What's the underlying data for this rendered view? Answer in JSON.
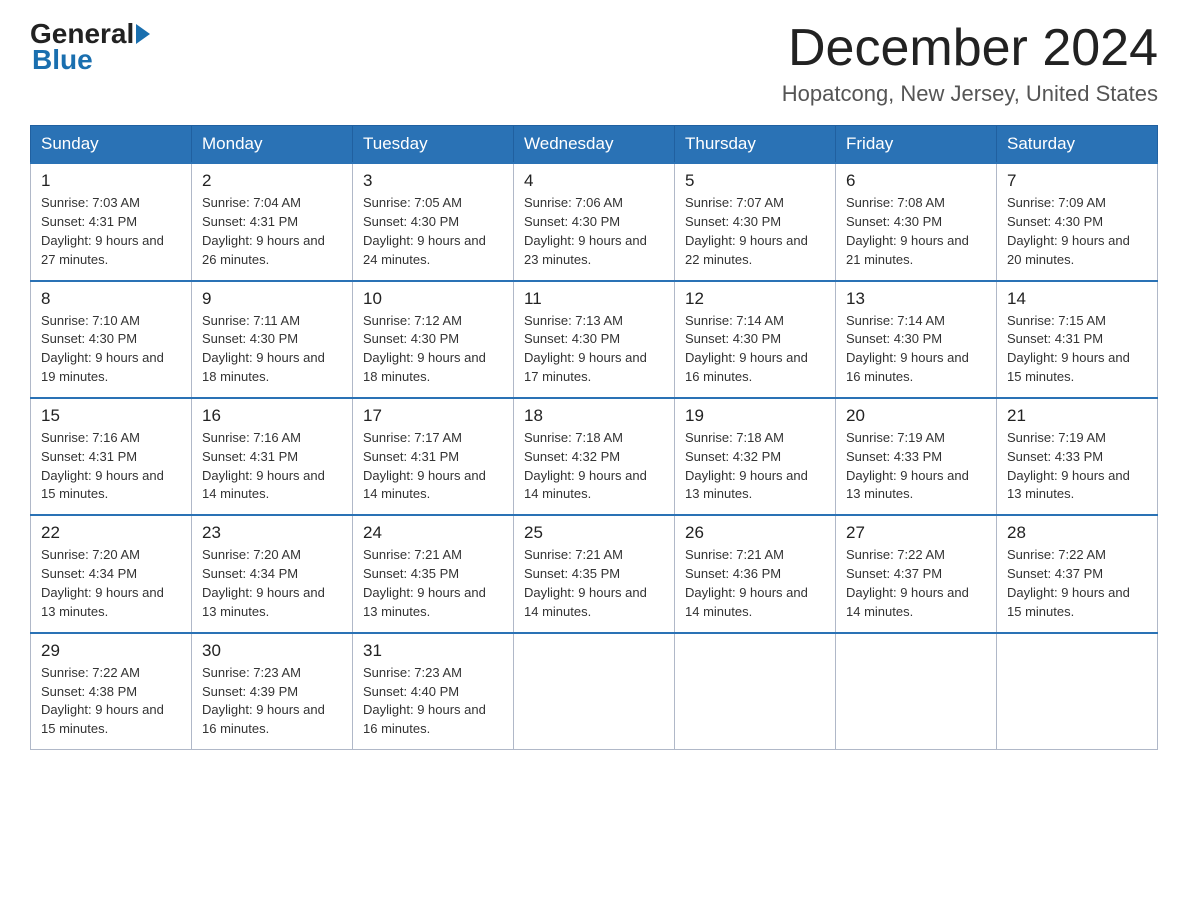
{
  "logo": {
    "general": "General",
    "blue": "Blue"
  },
  "header": {
    "month": "December 2024",
    "location": "Hopatcong, New Jersey, United States"
  },
  "weekdays": [
    "Sunday",
    "Monday",
    "Tuesday",
    "Wednesday",
    "Thursday",
    "Friday",
    "Saturday"
  ],
  "weeks": [
    [
      {
        "day": "1",
        "sunrise": "7:03 AM",
        "sunset": "4:31 PM",
        "daylight": "9 hours and 27 minutes."
      },
      {
        "day": "2",
        "sunrise": "7:04 AM",
        "sunset": "4:31 PM",
        "daylight": "9 hours and 26 minutes."
      },
      {
        "day": "3",
        "sunrise": "7:05 AM",
        "sunset": "4:30 PM",
        "daylight": "9 hours and 24 minutes."
      },
      {
        "day": "4",
        "sunrise": "7:06 AM",
        "sunset": "4:30 PM",
        "daylight": "9 hours and 23 minutes."
      },
      {
        "day": "5",
        "sunrise": "7:07 AM",
        "sunset": "4:30 PM",
        "daylight": "9 hours and 22 minutes."
      },
      {
        "day": "6",
        "sunrise": "7:08 AM",
        "sunset": "4:30 PM",
        "daylight": "9 hours and 21 minutes."
      },
      {
        "day": "7",
        "sunrise": "7:09 AM",
        "sunset": "4:30 PM",
        "daylight": "9 hours and 20 minutes."
      }
    ],
    [
      {
        "day": "8",
        "sunrise": "7:10 AM",
        "sunset": "4:30 PM",
        "daylight": "9 hours and 19 minutes."
      },
      {
        "day": "9",
        "sunrise": "7:11 AM",
        "sunset": "4:30 PM",
        "daylight": "9 hours and 18 minutes."
      },
      {
        "day": "10",
        "sunrise": "7:12 AM",
        "sunset": "4:30 PM",
        "daylight": "9 hours and 18 minutes."
      },
      {
        "day": "11",
        "sunrise": "7:13 AM",
        "sunset": "4:30 PM",
        "daylight": "9 hours and 17 minutes."
      },
      {
        "day": "12",
        "sunrise": "7:14 AM",
        "sunset": "4:30 PM",
        "daylight": "9 hours and 16 minutes."
      },
      {
        "day": "13",
        "sunrise": "7:14 AM",
        "sunset": "4:30 PM",
        "daylight": "9 hours and 16 minutes."
      },
      {
        "day": "14",
        "sunrise": "7:15 AM",
        "sunset": "4:31 PM",
        "daylight": "9 hours and 15 minutes."
      }
    ],
    [
      {
        "day": "15",
        "sunrise": "7:16 AM",
        "sunset": "4:31 PM",
        "daylight": "9 hours and 15 minutes."
      },
      {
        "day": "16",
        "sunrise": "7:16 AM",
        "sunset": "4:31 PM",
        "daylight": "9 hours and 14 minutes."
      },
      {
        "day": "17",
        "sunrise": "7:17 AM",
        "sunset": "4:31 PM",
        "daylight": "9 hours and 14 minutes."
      },
      {
        "day": "18",
        "sunrise": "7:18 AM",
        "sunset": "4:32 PM",
        "daylight": "9 hours and 14 minutes."
      },
      {
        "day": "19",
        "sunrise": "7:18 AM",
        "sunset": "4:32 PM",
        "daylight": "9 hours and 13 minutes."
      },
      {
        "day": "20",
        "sunrise": "7:19 AM",
        "sunset": "4:33 PM",
        "daylight": "9 hours and 13 minutes."
      },
      {
        "day": "21",
        "sunrise": "7:19 AM",
        "sunset": "4:33 PM",
        "daylight": "9 hours and 13 minutes."
      }
    ],
    [
      {
        "day": "22",
        "sunrise": "7:20 AM",
        "sunset": "4:34 PM",
        "daylight": "9 hours and 13 minutes."
      },
      {
        "day": "23",
        "sunrise": "7:20 AM",
        "sunset": "4:34 PM",
        "daylight": "9 hours and 13 minutes."
      },
      {
        "day": "24",
        "sunrise": "7:21 AM",
        "sunset": "4:35 PM",
        "daylight": "9 hours and 13 minutes."
      },
      {
        "day": "25",
        "sunrise": "7:21 AM",
        "sunset": "4:35 PM",
        "daylight": "9 hours and 14 minutes."
      },
      {
        "day": "26",
        "sunrise": "7:21 AM",
        "sunset": "4:36 PM",
        "daylight": "9 hours and 14 minutes."
      },
      {
        "day": "27",
        "sunrise": "7:22 AM",
        "sunset": "4:37 PM",
        "daylight": "9 hours and 14 minutes."
      },
      {
        "day": "28",
        "sunrise": "7:22 AM",
        "sunset": "4:37 PM",
        "daylight": "9 hours and 15 minutes."
      }
    ],
    [
      {
        "day": "29",
        "sunrise": "7:22 AM",
        "sunset": "4:38 PM",
        "daylight": "9 hours and 15 minutes."
      },
      {
        "day": "30",
        "sunrise": "7:23 AM",
        "sunset": "4:39 PM",
        "daylight": "9 hours and 16 minutes."
      },
      {
        "day": "31",
        "sunrise": "7:23 AM",
        "sunset": "4:40 PM",
        "daylight": "9 hours and 16 minutes."
      },
      null,
      null,
      null,
      null
    ]
  ]
}
